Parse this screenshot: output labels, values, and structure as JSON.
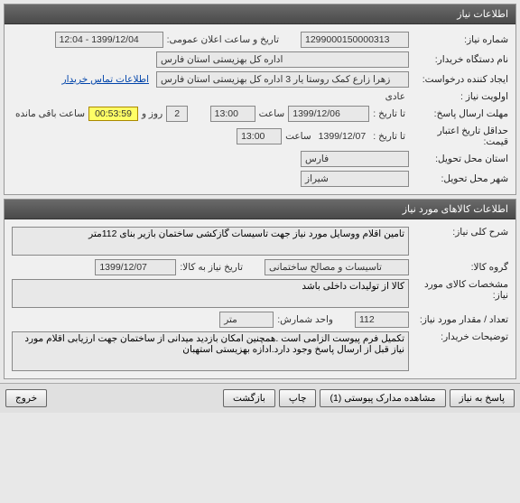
{
  "panel1": {
    "title": "اطلاعات نیاز",
    "need_no_label": "شماره نیاز:",
    "need_no": "1299000150000313",
    "announce_label": "تاریخ و ساعت اعلان عمومی:",
    "announce_val": "1399/12/04 - 12:04",
    "buyer_org_label": "نام دستگاه خریدار:",
    "buyer_org": "اداره کل بهزیستی استان فارس",
    "creator_label": "ایجاد کننده درخواست:",
    "creator": "زهرا زارع کمک روستا یار 3 اداره کل بهزیستی استان فارس",
    "contact_link": "اطلاعات تماس خریدار",
    "priority_label": "اولویت نیاز :",
    "priority": "عادی",
    "deadline_label": "مهلت ارسال پاسخ:",
    "until_label": "تا تاریخ :",
    "until_date": "1399/12/06",
    "time_label": "ساعت",
    "until_time": "13:00",
    "days_val": "2",
    "days_label": "روز و",
    "countdown": "00:53:59",
    "remain_label": "ساعت باقی مانده",
    "credit_label": "حداقل تاریخ اعتبار قیمت:",
    "credit_until_label": "تا تاریخ :",
    "credit_date": "1399/12/07",
    "credit_time": "13:00",
    "province_label": "استان محل تحویل:",
    "province": "فارس",
    "city_label": "شهر محل تحویل:",
    "city": "شیراز"
  },
  "panel2": {
    "title": "اطلاعات کالاهای مورد نیاز",
    "desc_label": "شرح کلی نیاز:",
    "desc": "تامین اقلام ووسایل مورد نیاز جهت تاسیسات گازکشی ساختمان بازیر بنای 112متر",
    "group_label": "گروه کالا:",
    "group": "تاسیسات و مصالح ساختمانی",
    "need_date_label": "تاریخ نیاز به کالا:",
    "need_date": "1399/12/07",
    "spec_label": "مشخصات کالای مورد نیاز:",
    "spec": "کالا از تولیدات داخلی باشد",
    "qty_label": "تعداد / مقدار مورد نیاز:",
    "qty": "112",
    "unit_label": "واحد شمارش:",
    "unit": "متر",
    "notes_label": "توضیحات خریدار:",
    "notes": "تکمیل فرم پیوست الزامی است .همچنین امکان بازدید میدانی از ساختمان جهت ارزیابی اقلام مورد نیاز قبل از ارسال پاسخ وجود دارد.ادازه بهزیستی استهبان"
  },
  "buttons": {
    "reply": "پاسخ به نیاز",
    "attach": "مشاهده مدارک پیوستی  (1)",
    "print": "چاپ",
    "back": "بازگشت",
    "exit": "خروج"
  }
}
